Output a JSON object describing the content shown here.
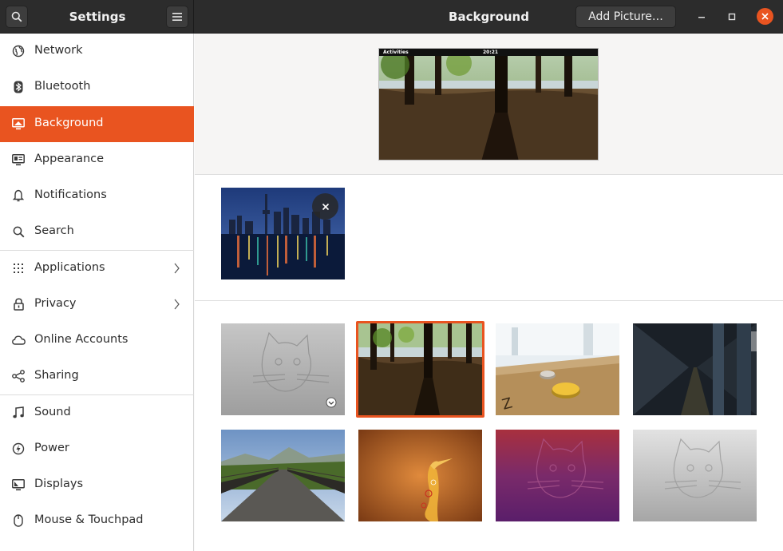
{
  "header": {
    "app_title": "Settings",
    "page_title": "Background",
    "add_picture_label": "Add Picture…"
  },
  "sidebar": {
    "items": [
      {
        "label": "Network",
        "icon": "network-icon"
      },
      {
        "label": "Bluetooth",
        "icon": "bluetooth-icon"
      },
      {
        "label": "Background",
        "icon": "background-icon",
        "active": true
      },
      {
        "label": "Appearance",
        "icon": "appearance-icon"
      },
      {
        "label": "Notifications",
        "icon": "bell-icon"
      },
      {
        "label": "Search",
        "icon": "search-icon"
      },
      {
        "label": "Applications",
        "icon": "apps-grid-icon",
        "submenu": true
      },
      {
        "label": "Privacy",
        "icon": "lock-icon",
        "submenu": true
      },
      {
        "label": "Online Accounts",
        "icon": "cloud-icon"
      },
      {
        "label": "Sharing",
        "icon": "share-icon"
      },
      {
        "label": "Sound",
        "icon": "music-note-icon"
      },
      {
        "label": "Power",
        "icon": "power-icon"
      },
      {
        "label": "Displays",
        "icon": "display-icon"
      },
      {
        "label": "Mouse & Touchpad",
        "icon": "mouse-icon"
      }
    ]
  },
  "preview": {
    "topbar_left": "Activities",
    "topbar_clock": "20:21"
  },
  "colors": {
    "accent": "#e95420",
    "headerbar": "#2c2c2c"
  }
}
